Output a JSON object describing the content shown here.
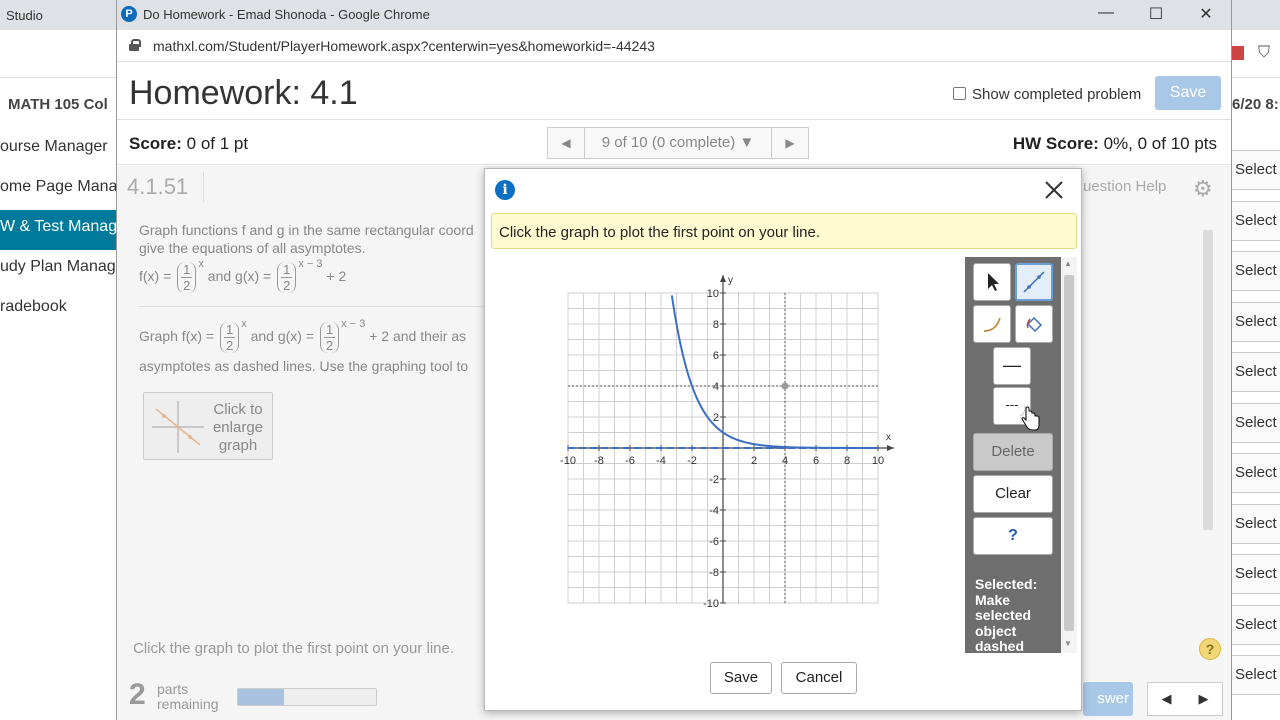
{
  "background": {
    "tab_text": "Studio",
    "course_title": "MATH 105 Col",
    "date_fragment": "6/20 8:",
    "sidebar": [
      {
        "label": "ourse Manager",
        "active": false
      },
      {
        "label": "ome Page Mana",
        "active": false
      },
      {
        "label": "W & Test Manag",
        "active": true
      },
      {
        "label": "udy Plan Manag",
        "active": false
      },
      {
        "label": "radebook",
        "active": false
      }
    ],
    "select_label": "Select -"
  },
  "window": {
    "title": "Do Homework - Emad Shonoda - Google Chrome",
    "favicon": "P",
    "url": "mathxl.com/Student/PlayerHomework.aspx?centerwin=yes&homeworkid=-44243",
    "minimize": "—",
    "maximize": "☐",
    "close": "✕"
  },
  "header": {
    "title": "Homework: 4.1",
    "show_completed_label": "Show completed problem",
    "save_label": "Save"
  },
  "score": {
    "score_label": "Score:",
    "score_value": "0 of 1 pt",
    "nav_text": "9 of 10 (0 complete)",
    "hw_score_label": "HW Score:",
    "hw_score_value": "0%, 0 of 10 pts"
  },
  "question": {
    "id": "4.1.51",
    "help_label": "uestion Help",
    "text_line1": "Graph functions f and g in the same rectangular coord",
    "text_line2": "give the equations of all asymptotes.",
    "f_prefix": "f(x) =",
    "and_g": "and g(x) =",
    "frac_num": "1",
    "frac_den": "2",
    "exp_f": "x",
    "exp_g": "x − 3",
    "plus2": "+ 2",
    "graph_prefix": "Graph f(x) =",
    "graph_and": "and g(x) =",
    "graph_suffix": "+ 2 and their as",
    "text_line3": "asymptotes as dashed lines. Use the graphing tool to",
    "enlarge_label": "Click to enlarge graph",
    "bottom_msg": "Click the graph to plot the first point on your line.",
    "parts_num": "2",
    "parts_label1": "parts",
    "parts_label2": "remaining",
    "parts_progress": 0.33,
    "help_q": "?",
    "check_answer": "swer"
  },
  "modal": {
    "hint": "Click the graph to plot the first point on your line.",
    "delete_label": "Delete",
    "clear_label": "Clear",
    "help_label": "?",
    "selected_info": "Selected: Make selected object dashed",
    "save_label": "Save",
    "cancel_label": "Cancel",
    "solid_line_glyph": "—",
    "dashed_line_glyph": "---"
  },
  "chart_data": {
    "type": "line",
    "xlabel": "x",
    "ylabel": "y",
    "xlim": [
      -10,
      10
    ],
    "ylim": [
      -10,
      10
    ],
    "xticks": [
      -10,
      -8,
      -6,
      -4,
      -2,
      2,
      4,
      6,
      8,
      10
    ],
    "yticks": [
      -10,
      -8,
      -6,
      -4,
      -2,
      2,
      4,
      6,
      8,
      10
    ],
    "grid": true,
    "series": [
      {
        "curve": "exponential",
        "base": 0.5,
        "x_from": -3.3,
        "x_to": 10,
        "color": "#3a6fc4"
      }
    ],
    "asymptote_y": 0,
    "dotted_guides": {
      "x": 4,
      "y": 4
    },
    "guide_point": [
      4,
      4
    ]
  }
}
